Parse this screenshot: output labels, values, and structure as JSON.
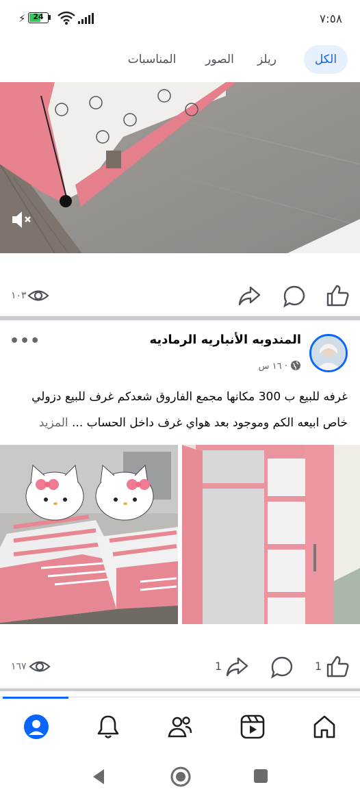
{
  "status_bar": {
    "time": "٧:٥٨",
    "battery": "24"
  },
  "tabs": [
    {
      "label": "الكل",
      "active": true
    },
    {
      "label": "ريلز",
      "active": false
    },
    {
      "label": "الصور",
      "active": false
    },
    {
      "label": "المناسبات",
      "active": false
    }
  ],
  "post1": {
    "views": "١٠٣"
  },
  "post2": {
    "author": "المندوبه الأنباريه الرماديه",
    "time": "١٦ س",
    "dot": "·",
    "text_line1": "غرفه للبيع ب 300 مكانها مجمع الفاروق شعدكم غرف للبيع دزولي",
    "text_line2": "خاص ابيعه الكم  وموجود بعد هواي غرف داخل الحساب ...",
    "see_more": "المزيد",
    "like_count": "1",
    "share_count": "1",
    "views": "١٦٧"
  },
  "colors": {
    "accent": "#0866ff",
    "tab_active_bg": "#e7f0fd",
    "furniture_pink": "#e98b97"
  },
  "icons": [
    "search-icon"
  ]
}
